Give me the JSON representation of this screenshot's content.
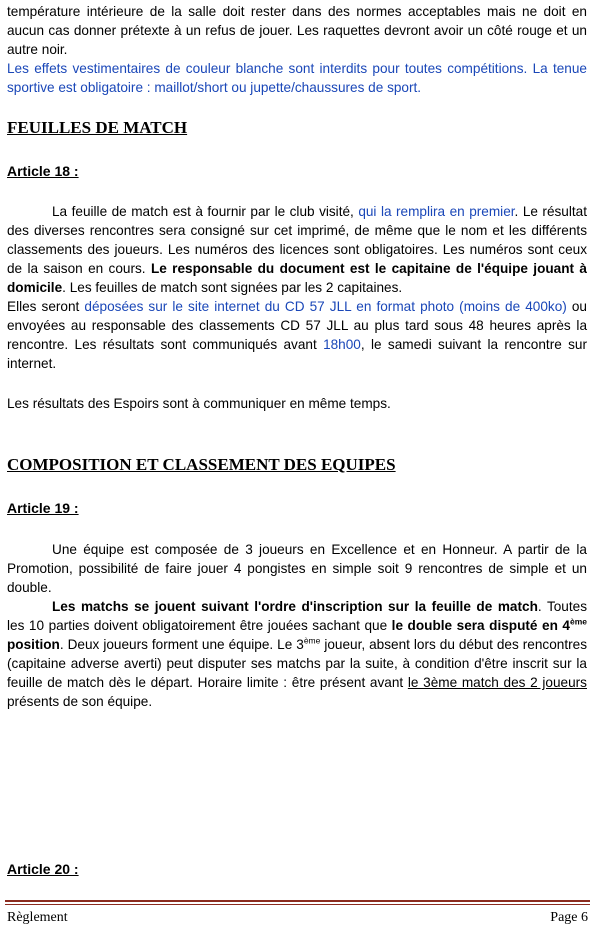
{
  "intro": {
    "line1": "température intérieure de la salle doit rester dans des normes acceptables mais ne doit en aucun cas donner prétexte à un refus de jouer. Les raquettes devront avoir un côté rouge et un autre noir.",
    "line2": "Les effets vestimentaires de couleur blanche sont interdits pour toutes compétitions. La tenue sportive est obligatoire : maillot/short ou jupette/chaussures de sport."
  },
  "section1": {
    "title": "FEUILLES DE MATCH"
  },
  "article18": {
    "title": "Article 18 :",
    "p1_a": "La feuille de match est à fournir par le club visité, ",
    "p1_b": "qui la remplira en premier",
    "p1_c": ". Le résultat des diverses rencontres sera consigné sur cet imprimé, de même que le nom et les différents classements des joueurs. Les numéros des licences sont obligatoires. Les numéros sont ceux de la saison en cours. ",
    "p1_d": "Le responsable du document est le capitaine de l'équipe jouant à domicile",
    "p1_e": ". Les feuilles de match sont signées par les 2 capitaines.",
    "p2_a": "Elles seront ",
    "p2_b": "déposées sur le site internet du CD 57 JLL en format photo (moins de 400ko)",
    "p2_c": " ou envoyées au responsable des classements CD 57 JLL au plus tard sous 48 heures après la rencontre. Les résultats sont communiqués avant ",
    "p2_d": "18h00",
    "p2_e": ", le samedi suivant la rencontre sur internet.",
    "p3": "Les résultats des Espoirs sont à communiquer en même temps."
  },
  "section2": {
    "title": "COMPOSITION ET CLASSEMENT DES EQUIPES"
  },
  "article19": {
    "title": "Article 19 :",
    "p1": "Une équipe est composée de 3 joueurs en Excellence et en Honneur. A partir de la Promotion, possibilité de faire jouer 4 pongistes en simple soit 9 rencontres de simple et un double.",
    "p2_a": "Les matchs se jouent suivant l'ordre d'inscription sur la feuille de match",
    "p2_b": ". Toutes les 10 parties doivent obligatoirement être jouées sachant que ",
    "p2_c": "le double sera disputé en 4",
    "p2_sup1": "ème",
    "p2_d": " position",
    "p2_e": ". Deux joueurs forment une équipe. Le 3",
    "p2_sup2": "ème",
    "p2_f": " joueur, absent lors du début des rencontres (capitaine adverse averti) peut disputer ses matchs par la suite, à condition d'être inscrit sur la feuille de match dès le départ. Horaire limite : être présent avant ",
    "p2_g": "le 3ème match des 2 joueurs",
    "p2_h": " présents de son équipe."
  },
  "article20": {
    "title": "Article 20 :"
  },
  "footer": {
    "left": "Règlement",
    "right": "Page 6"
  }
}
